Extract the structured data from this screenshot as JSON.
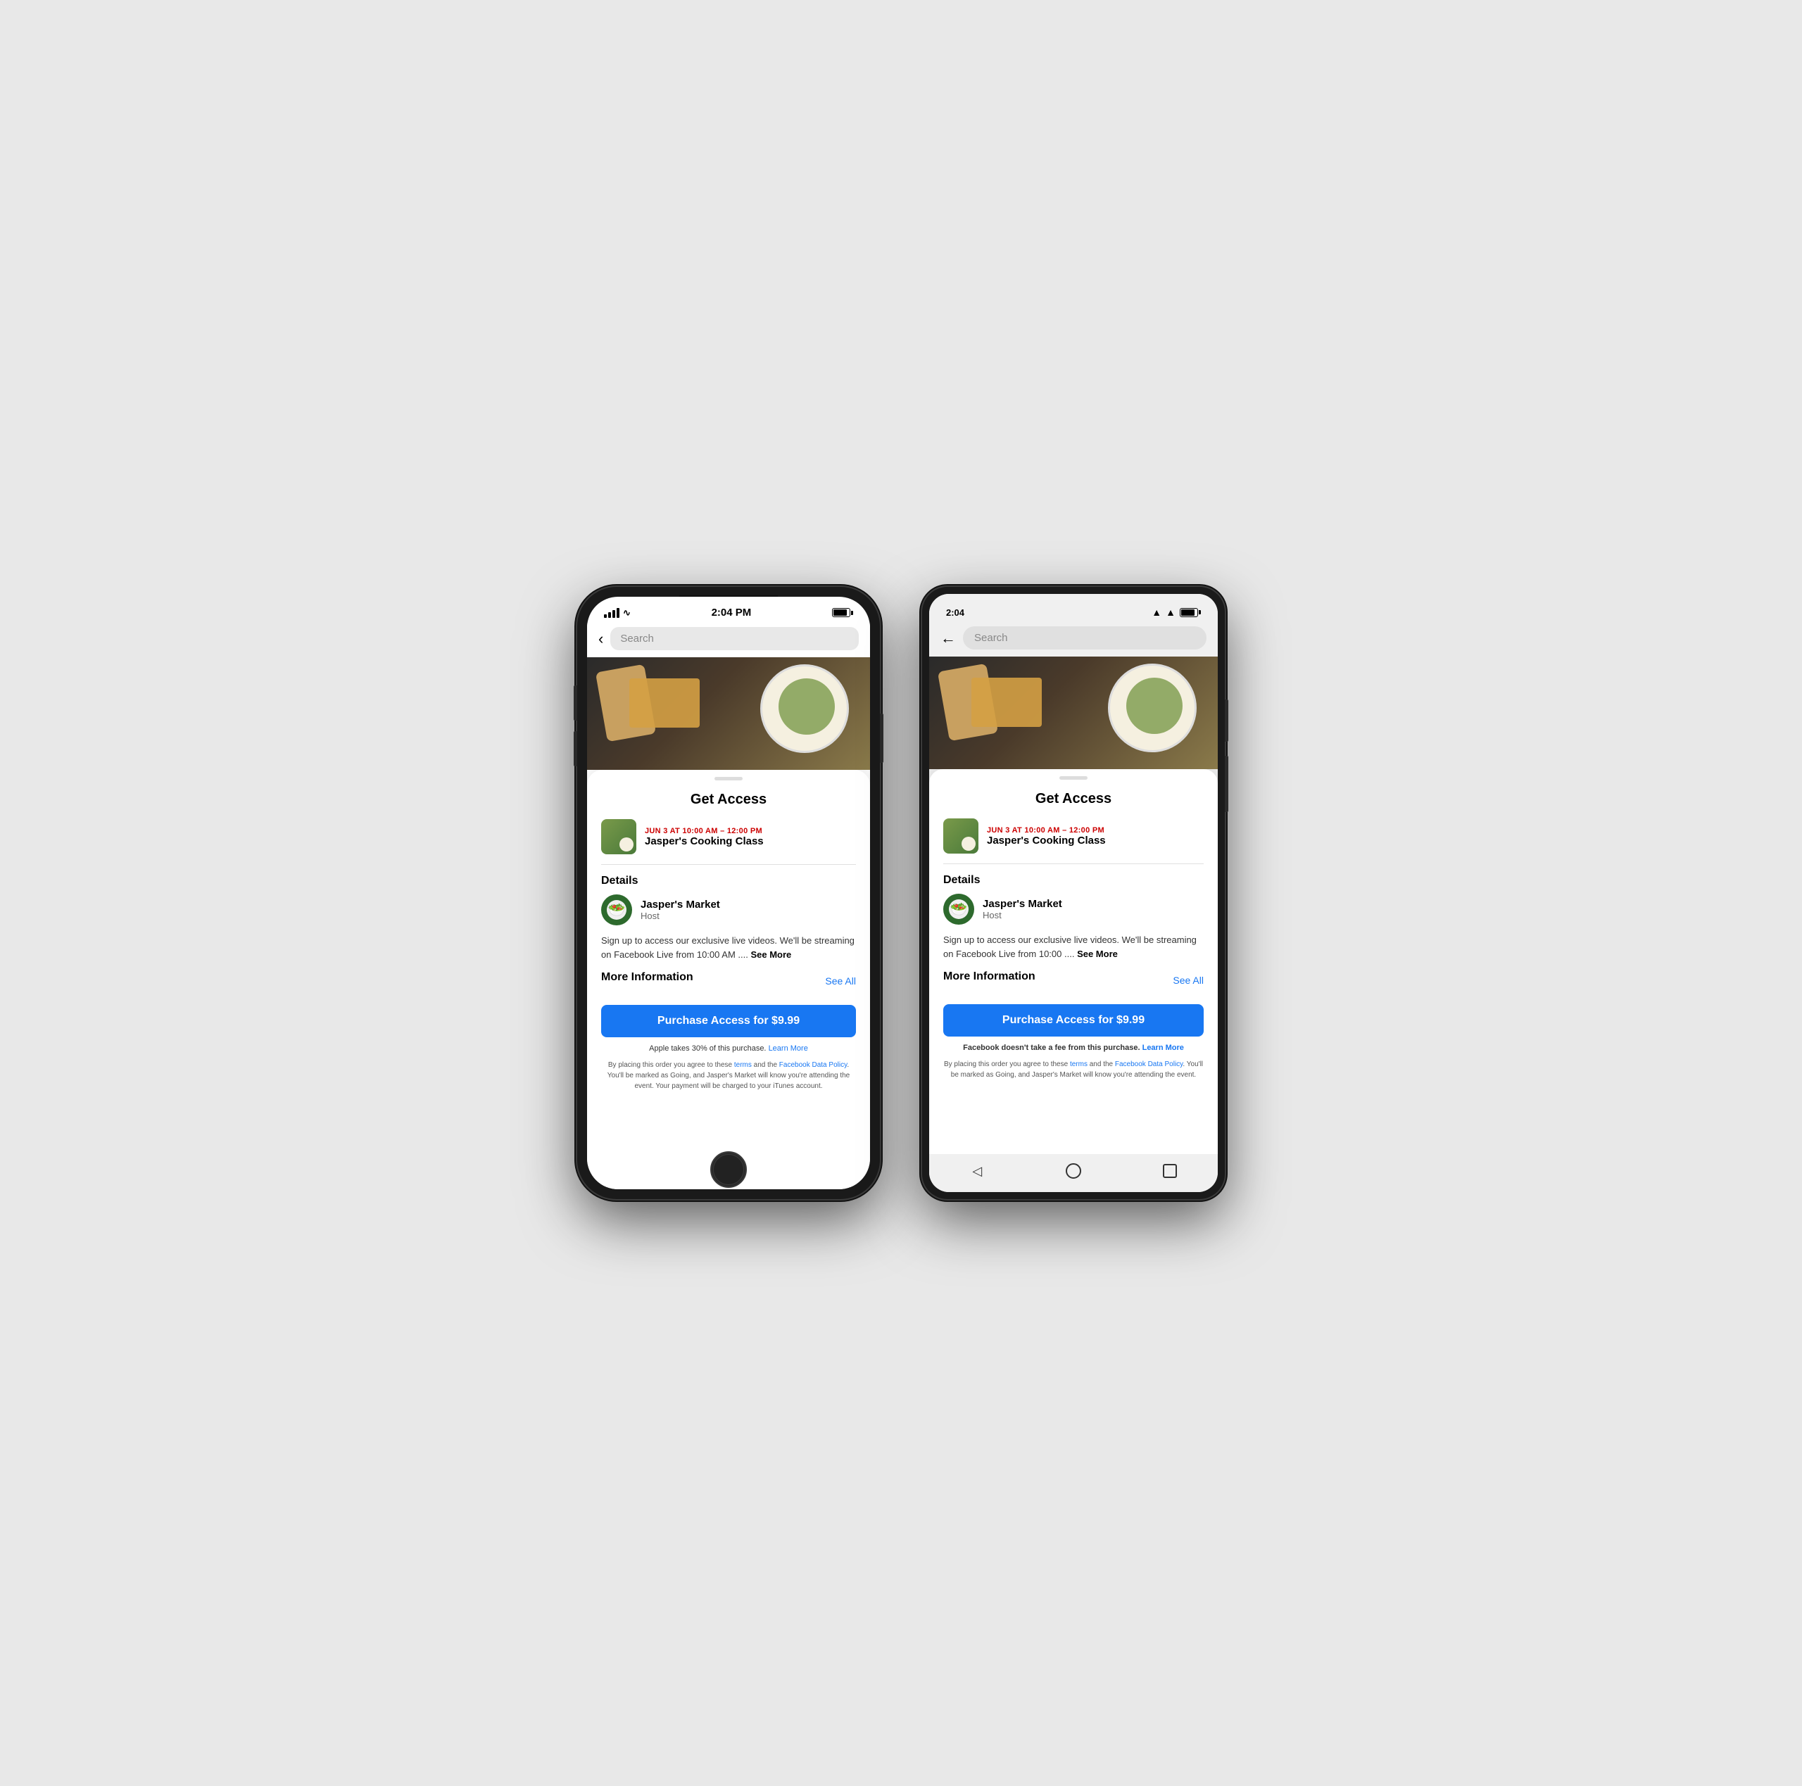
{
  "page": {
    "background": "#e8e8e8"
  },
  "iphone": {
    "status_bar": {
      "signal": "signal",
      "wifi": "wifi",
      "time": "2:04 PM",
      "battery": "battery"
    },
    "search": {
      "back_label": "‹",
      "placeholder": "Search"
    },
    "sheet": {
      "title": "Get Access",
      "event_date": "JUN 3 AT 10:00 AM – 12:00 PM",
      "event_name": "Jasper's Cooking Class",
      "details_label": "Details",
      "host_name": "Jasper's Market",
      "host_role": "Host",
      "description": "Sign up to access our exclusive live videos. We'll be streaming on Facebook Live from 10:00 AM ....",
      "see_more": "See More",
      "more_info_label": "More Information",
      "see_all": "See All",
      "purchase_btn": "Purchase Access for $9.99",
      "apple_fee": "Apple takes 30% of this purchase.",
      "learn_more": "Learn More",
      "terms": "By placing this order you agree to these terms and the Facebook Data Policy. You'll be marked as Going, and Jasper's Market will know you're attending the event. Your payment will be charged to your iTunes account."
    }
  },
  "android": {
    "status_bar": {
      "time": "2:04",
      "wifi": "wifi",
      "signal": "signal",
      "battery": "battery"
    },
    "search": {
      "back_label": "←",
      "placeholder": "Search"
    },
    "sheet": {
      "title": "Get Access",
      "event_date": "JUN 3 AT 10:00 AM – 12:00 PM",
      "event_name": "Jasper's Cooking Class",
      "details_label": "Details",
      "host_name": "Jasper's Market",
      "host_role": "Host",
      "description": "Sign up to access our exclusive live videos. We'll be streaming on Facebook Live from 10:00 ....",
      "see_more": "See More",
      "more_info_label": "More Information",
      "see_all": "See All",
      "purchase_btn": "Purchase Access for $9.99",
      "fb_fee": "Facebook doesn't take a fee from this purchase.",
      "learn_more": "Learn More",
      "terms": "By placing this order you agree to these terms and the Facebook Data Policy. You'll be marked as Going, and Jasper's Market will know you're attending the event."
    },
    "nav": {
      "back": "◁",
      "home": "○",
      "recent": "□"
    }
  }
}
